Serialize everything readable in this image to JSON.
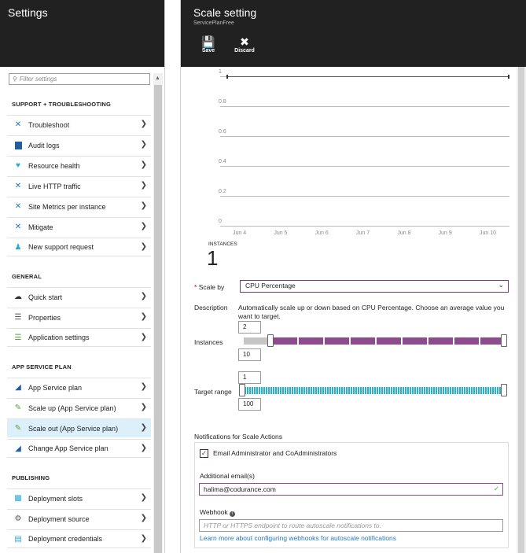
{
  "left": {
    "title": "Settings",
    "filter_placeholder": "Filter settings",
    "sections": [
      {
        "label": "SUPPORT + TROUBLESHOOTING",
        "items": [
          "Troubleshoot",
          "Audit logs",
          "Resource health",
          "Live HTTP traffic",
          "Site Metrics per instance",
          "Mitigate",
          "New support request"
        ]
      },
      {
        "label": "GENERAL",
        "items": [
          "Quick start",
          "Properties",
          "Application settings"
        ]
      },
      {
        "label": "APP SERVICE PLAN",
        "items": [
          "App Service plan",
          "Scale up (App Service plan)",
          "Scale out (App Service plan)",
          "Change App Service plan"
        ]
      },
      {
        "label": "PUBLISHING",
        "items": [
          "Deployment slots",
          "Deployment source",
          "Deployment credentials"
        ]
      }
    ],
    "selected": "Scale out (App Service plan)"
  },
  "right": {
    "title": "Scale setting",
    "subtitle": "ServicePlanFree",
    "save_label": "Save",
    "discard_label": "Discard",
    "instances_label": "INSTANCES",
    "instances_count": "1",
    "scale_by_label": "Scale by",
    "scale_by_value": "CPU Percentage",
    "description_label": "Description",
    "description_text": "Automatically scale up or down based on CPU Percentage. Choose an average value you want to target.",
    "instances_field_label": "Instances",
    "instances_min": "2",
    "instances_max": "10",
    "target_range_label": "Target range",
    "target_min": "1",
    "target_max": "100",
    "notifications_title": "Notifications for Scale Actions",
    "email_admins_label": "Email Administrator and CoAdministrators",
    "additional_email_label": "Additional email(s)",
    "additional_email_value": "halima@codurance.com",
    "webhook_label": "Webhook",
    "webhook_placeholder": "HTTP or HTTPS endpoint to route autoscale notifications to.",
    "learn_more": "Learn more about configuring webhooks for autoscale notifications"
  },
  "chart_data": {
    "type": "line",
    "y_ticks": [
      "1",
      "0.8",
      "0.6",
      "0.4",
      "0.2",
      "0"
    ],
    "x_ticks": [
      "Jun 4",
      "Jun 5",
      "Jun 6",
      "Jun 7",
      "Jun 8",
      "Jun 9",
      "Jun 10"
    ],
    "ylim": [
      0,
      1
    ],
    "series": [
      {
        "values": [
          1,
          1,
          1,
          1,
          1,
          1,
          1
        ]
      }
    ]
  },
  "colors": {
    "accent": "#8e4a8e",
    "target": "#26b1c9",
    "header": "#212121"
  }
}
